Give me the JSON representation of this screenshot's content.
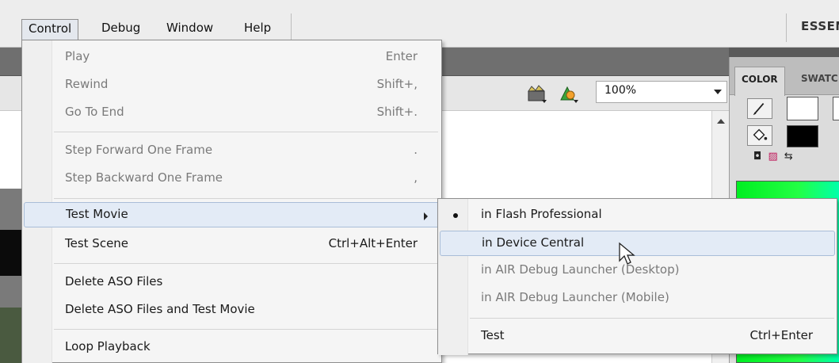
{
  "menubar": {
    "items": [
      {
        "label": "Control"
      },
      {
        "label": "Debug"
      },
      {
        "label": "Window"
      },
      {
        "label": "Help"
      }
    ],
    "workspace": "ESSEN"
  },
  "toolbar": {
    "zoom": "100%",
    "icons": [
      "edit-scene-icon",
      "edit-symbols-icon"
    ]
  },
  "color_panel": {
    "tabs": [
      "COLOR",
      "SWATC"
    ],
    "stroke_color": "#ffffff",
    "fill_color": "#000000",
    "gradient_color": "#00ee22"
  },
  "control_menu": {
    "items": [
      {
        "label": "Play",
        "shortcut": "Enter"
      },
      {
        "label": "Rewind",
        "shortcut": "Shift+,"
      },
      {
        "label": "Go To End",
        "shortcut": "Shift+."
      },
      {
        "label": "Step Forward One Frame",
        "shortcut": "."
      },
      {
        "label": "Step Backward One Frame",
        "shortcut": ","
      },
      {
        "label": "Test Movie",
        "shortcut": ""
      },
      {
        "label": "Test Scene",
        "shortcut": "Ctrl+Alt+Enter"
      },
      {
        "label": "Delete ASO Files",
        "shortcut": ""
      },
      {
        "label": "Delete ASO Files and Test Movie",
        "shortcut": ""
      },
      {
        "label": "Loop Playback",
        "shortcut": ""
      }
    ]
  },
  "test_movie_submenu": {
    "items": [
      {
        "label": "in Flash Professional",
        "shortcut": ""
      },
      {
        "label": "in Device Central",
        "shortcut": ""
      },
      {
        "label": "in AIR Debug Launcher (Desktop)",
        "shortcut": ""
      },
      {
        "label": "in AIR Debug Launcher (Mobile)",
        "shortcut": ""
      },
      {
        "label": "Test",
        "shortcut": "Ctrl+Enter"
      }
    ]
  }
}
